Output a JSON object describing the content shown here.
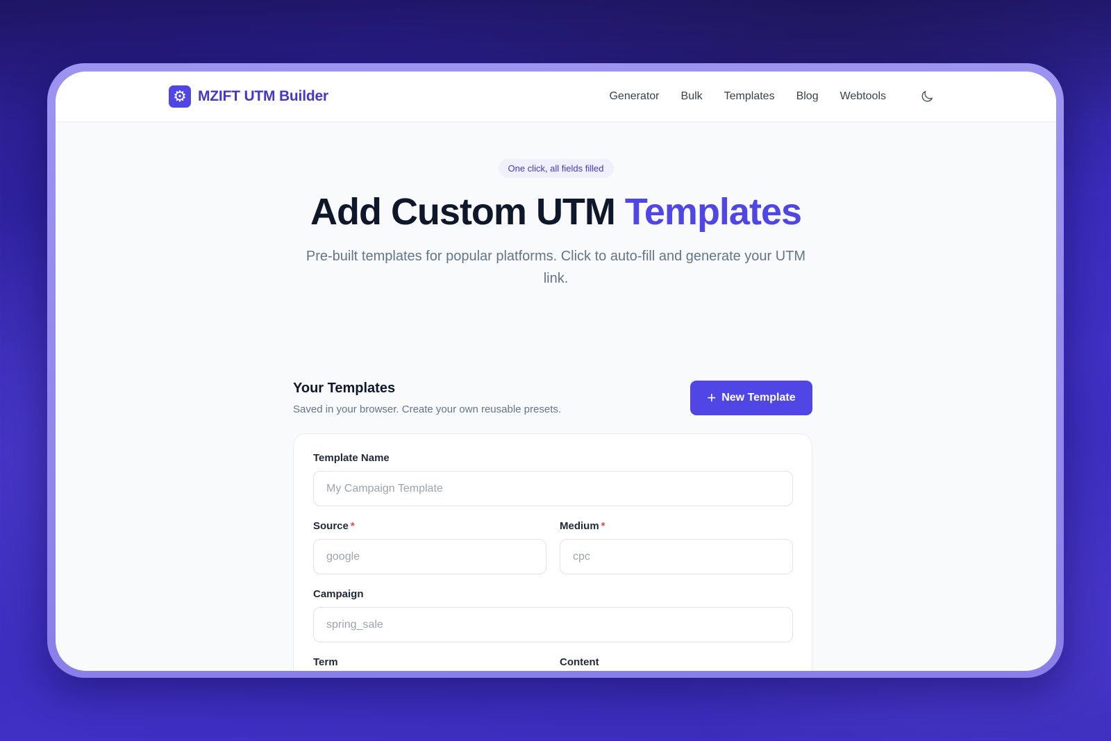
{
  "brand": {
    "name": "MZIFT UTM Builder",
    "accent": "#4f46e5"
  },
  "nav": {
    "items": [
      {
        "label": "Generator"
      },
      {
        "label": "Bulk"
      },
      {
        "label": "Templates"
      },
      {
        "label": "Blog"
      },
      {
        "label": "Webtools"
      }
    ],
    "theme_toggle_icon": "moon-icon"
  },
  "hero": {
    "pill": "One click, all fields filled",
    "title_main": "Add Custom UTM ",
    "title_accent": "Templates",
    "subtitle": "Pre-built templates for popular platforms. Click to auto-fill and generate your UTM link."
  },
  "templates": {
    "title": "Your Templates",
    "description": "Saved in your browser. Create your own reusable presets.",
    "new_button": "New Template",
    "form": {
      "name": {
        "label": "Template Name",
        "placeholder": "My Campaign Template"
      },
      "source": {
        "label": "Source",
        "required_mark": "*",
        "placeholder": "google"
      },
      "medium": {
        "label": "Medium",
        "required_mark": "*",
        "placeholder": "cpc"
      },
      "campaign": {
        "label": "Campaign",
        "placeholder": "spring_sale"
      },
      "term": {
        "label": "Term"
      },
      "content": {
        "label": "Content"
      }
    }
  }
}
